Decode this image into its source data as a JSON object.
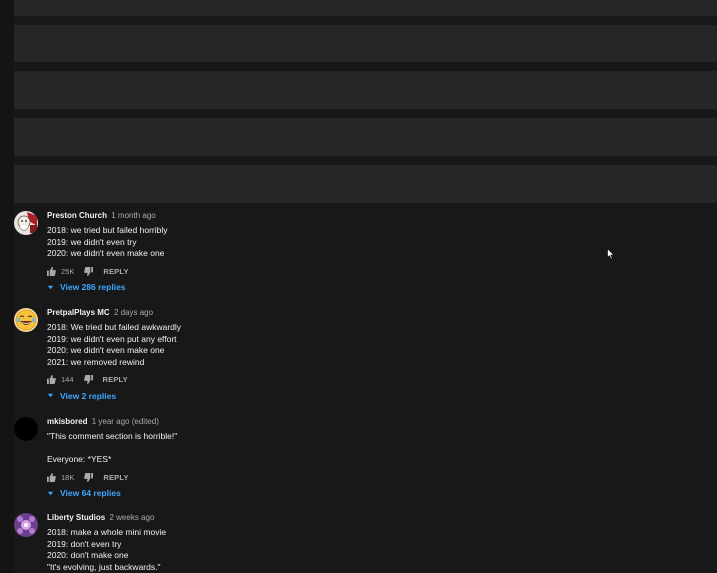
{
  "comments": [
    {
      "author": "Preston Church",
      "time": "1 month ago",
      "lines": [
        "2018: we tried but failed horribly",
        "2019: we didn't even try",
        "2020: we didn't even make one"
      ],
      "likes": "25K",
      "reply_label": "REPLY",
      "view_replies": "View 286 replies",
      "avatar_icon": "santa-avatar-icon"
    },
    {
      "author": "PretpalPlays MC",
      "time": "2 days ago",
      "lines": [
        "2018: We tried but failed awkwardly",
        "2019: we didn't even put any effort",
        "2020: we didn't even make one",
        "2021: we removed rewind"
      ],
      "likes": "144",
      "reply_label": "REPLY",
      "view_replies": "View 2 replies",
      "avatar_icon": "laughing-emoji-avatar-icon"
    },
    {
      "author": "mkisbored",
      "time": "1 year ago (edited)",
      "lines": [
        "\"This comment section is horrible!\"",
        "",
        "Everyone: *YES*"
      ],
      "likes": "18K",
      "reply_label": "REPLY",
      "view_replies": "View 64 replies",
      "avatar_icon": "black-circle-avatar-icon"
    },
    {
      "author": "Liberty Studios",
      "time": "2 weeks ago",
      "lines": [
        "2018: make a whole mini movie",
        "2019: don't even try",
        "2020: don't make one",
        "\"It's evolving, just backwards.\""
      ],
      "avatar_icon": "purple-pattern-avatar-icon"
    }
  ],
  "colors": {
    "background": "#181818",
    "placeholder": "#262626",
    "link": "#3ea6ff",
    "secondary_text": "#aaaaaa"
  }
}
